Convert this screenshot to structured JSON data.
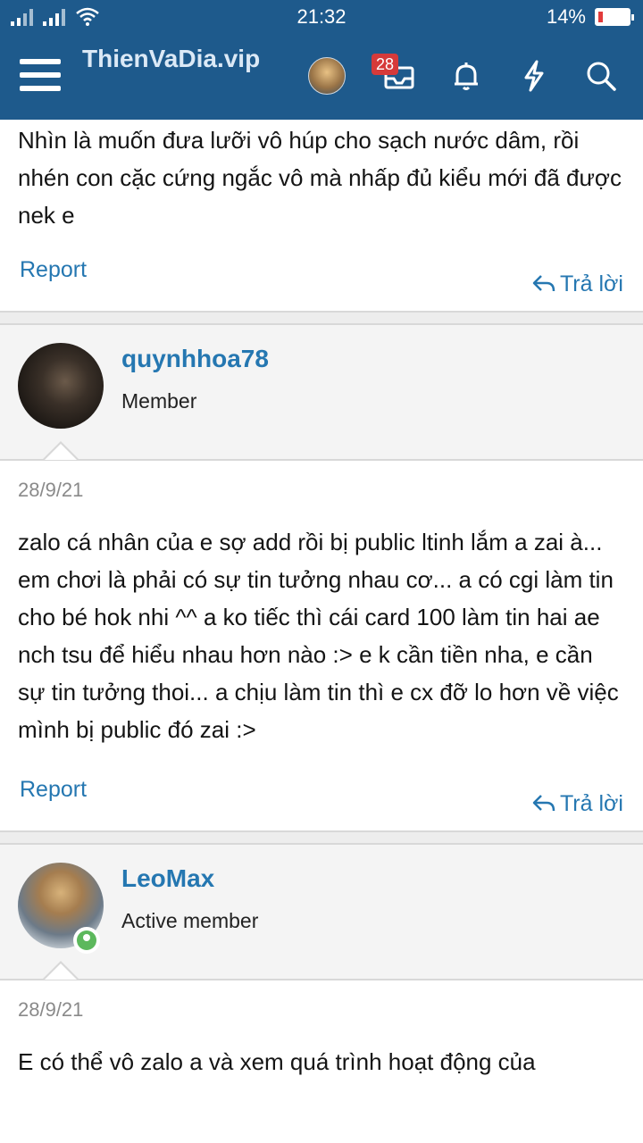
{
  "status_bar": {
    "time": "21:32",
    "battery": "14%",
    "battery_level": 0.14
  },
  "header": {
    "site_title": "ThienVaDia.vip",
    "notification_count": "28",
    "icons": [
      "menu-icon",
      "avatar",
      "inbox-icon",
      "bell-icon",
      "bolt-icon",
      "search-icon"
    ]
  },
  "top_post": {
    "body": "Nhìn là muốn đưa lưỡi vô húp cho sạch nước dâm, rồi nhén con cặc cứng ngắc vô mà nhấp đủ kiểu mới đã được nek e",
    "report_label": "Report",
    "reply_label": "Trả lời"
  },
  "posts": [
    {
      "username": "quynhhoa78",
      "user_title": "Member",
      "date": "28/9/21",
      "body": "zalo cá nhân của e sợ add rồi bị public ltinh lắm a zai à... em chơi là phải có sự tin tưởng nhau cơ... a có cgi làm tin cho bé hok nhi ^^ a ko tiếc thì cái card 100 làm tin hai ae nch tsu để hiểu nhau hơn nào :> e k cần tiền nha, e cần sự tin tưởng thoi... a chịu làm tin thì e cx đỡ lo hơn về việc mình bị public đó zai :>",
      "report_label": "Report",
      "reply_label": "Trả lời"
    },
    {
      "username": "LeoMax",
      "user_title": "Active member",
      "date": "28/9/21",
      "body": "E có thể vô zalo a và xem quá trình hoạt động của"
    }
  ],
  "colors": {
    "brand": "#1e5a8c",
    "link": "#2577b1",
    "badge": "#d63a3a",
    "online": "#5cb85c"
  }
}
